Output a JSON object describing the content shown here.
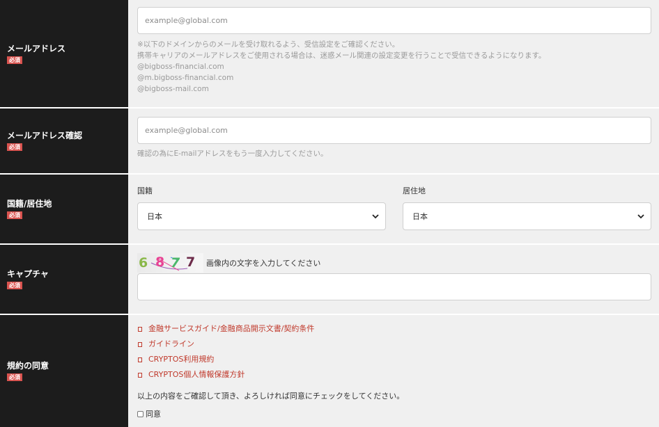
{
  "email": {
    "label": "メールアドレス",
    "required": "必須",
    "placeholder": "example@global.com",
    "hint_1": "※以下のドメインからのメールを受け取れるよう、受信設定をご確認ください。",
    "hint_2": "携帯キャリアのメールアドレスをご使用される場合は、迷惑メール関連の設定変更を行うことで受信できるようになります。",
    "domains": [
      "@bigboss-financial.com",
      "@m.bigboss-financial.com",
      "@bigboss-mail.com"
    ]
  },
  "email_confirm": {
    "label": "メールアドレス確認",
    "required": "必須",
    "placeholder": "example@global.com",
    "hint": "確認の為にE-mailアドレスをもう一度入力してください。"
  },
  "nationality": {
    "label": "国籍/居住地",
    "required": "必須",
    "country_label": "国籍",
    "country_value": "日本",
    "residence_label": "居住地",
    "residence_value": "日本"
  },
  "captcha": {
    "label": "キャプチャ",
    "required": "必須",
    "chars": [
      "6",
      "8",
      "7",
      "7"
    ],
    "instruction": "画像内の文字を入力してください"
  },
  "terms": {
    "label": "規約の同意",
    "required": "必須",
    "links": [
      "金融サービスガイド/金融商品開示文書/契約条件",
      "ガイドライン",
      "CRYPTOS利用規約",
      "CRYPTOS個人情報保護方針"
    ],
    "confirm_text": "以上の内容をご確認して頂き、よろしければ同意にチェックをしてください。",
    "agree_label": "同意"
  },
  "colors": {
    "label_bg": "#1c1c1c",
    "required_badge": "#d9534f",
    "link": "#c0392b",
    "field_bg": "#f0f0f0"
  }
}
